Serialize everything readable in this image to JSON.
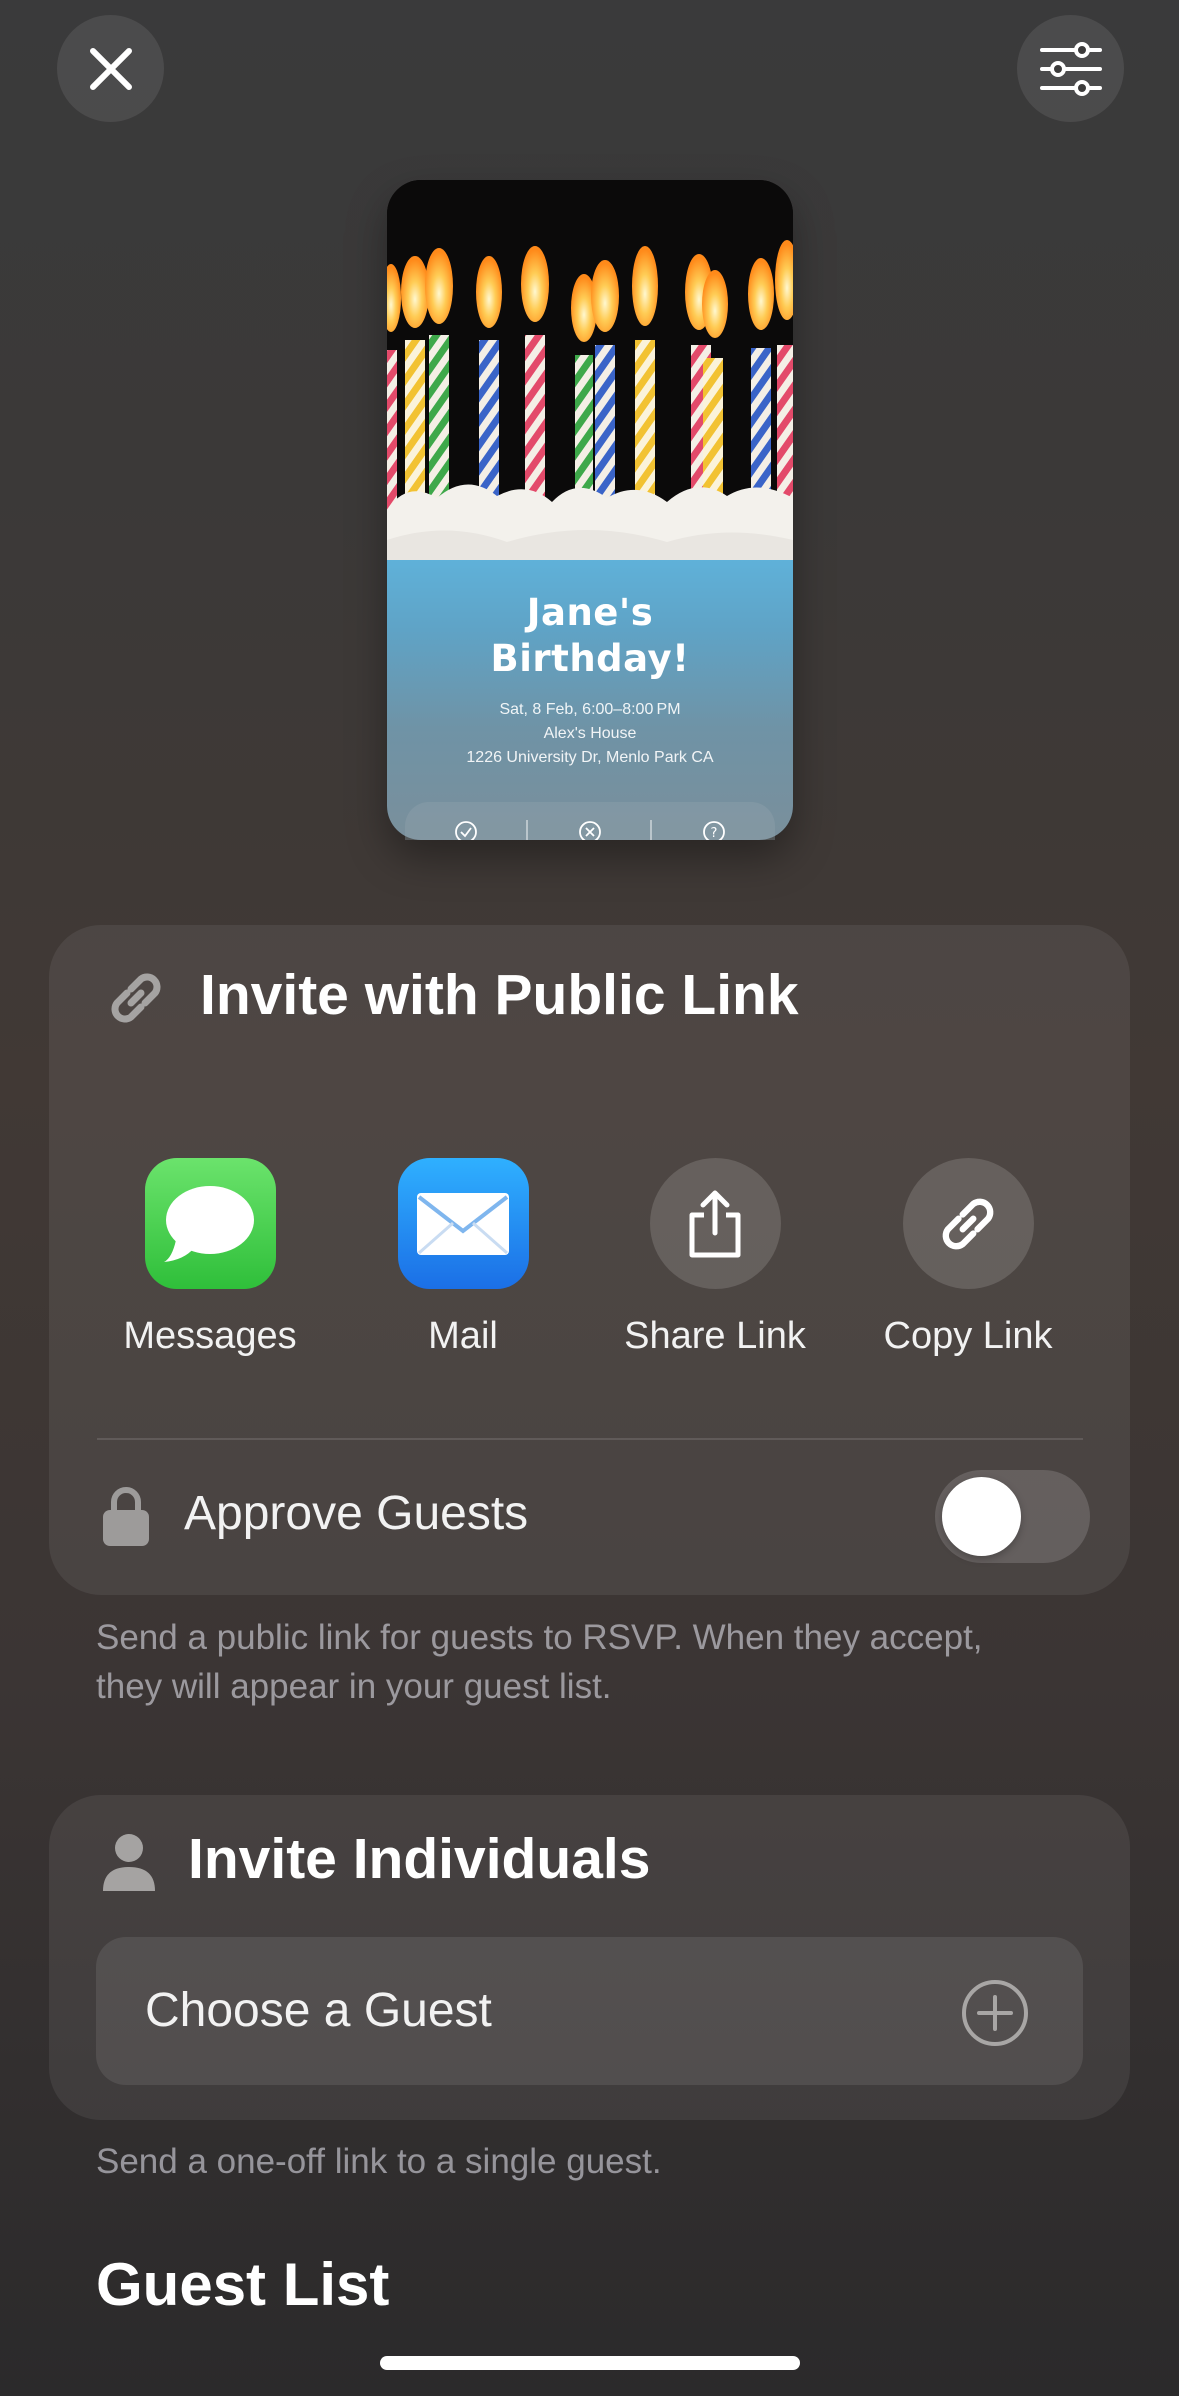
{
  "toolbar": {
    "close_icon": "xmark-icon",
    "settings_icon": "sliders-icon"
  },
  "invitation": {
    "title_line1": "Jane's",
    "title_line2": "Birthday!",
    "datetime": "Sat, 8 Feb, 6:00–8:00 PM",
    "venue": "Alex's House",
    "address": "1226 University Dr, Menlo Park CA",
    "rsvp_icons": [
      "check-circle-icon",
      "x-circle-icon",
      "question-circle-icon"
    ]
  },
  "public_link": {
    "title": "Invite with Public Link",
    "icon": "link-icon",
    "options": [
      {
        "label": "Messages",
        "icon": "messages-icon",
        "color": "#34c759"
      },
      {
        "label": "Mail",
        "icon": "mail-icon",
        "color": "#1e8cf0"
      },
      {
        "label": "Share Link",
        "icon": "share-icon"
      },
      {
        "label": "Copy Link",
        "icon": "link-icon"
      }
    ],
    "approve_label": "Approve Guests",
    "approve_icon": "lock-icon",
    "approve_enabled": false,
    "footnote": "Send a public link for guests to RSVP. When they accept, they will appear in your guest list."
  },
  "individuals": {
    "title": "Invite Individuals",
    "icon": "person-icon",
    "choose_label": "Choose a Guest",
    "add_icon": "plus-circle-icon",
    "footnote": "Send a one-off link to a single guest."
  },
  "guest_list": {
    "title": "Guest List"
  }
}
